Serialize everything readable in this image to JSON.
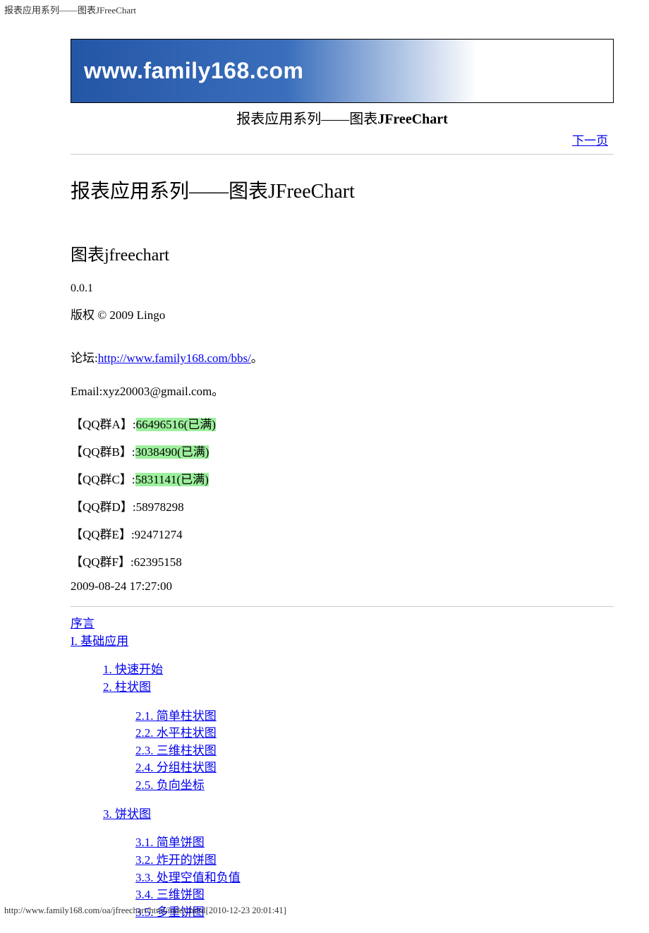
{
  "browserTitle": "报表应用系列——图表JFreeChart",
  "bannerText": "www.family168.com",
  "docBarTitlePrefix": "报表应用系列——图表",
  "docBarTitleBold": "JFreeChart",
  "nextPageLabel": "下一页",
  "mainTitle": "报表应用系列——图表JFreeChart",
  "subTitle": "图表jfreechart",
  "version": "0.0.1",
  "copyright": "版权 © 2009 Lingo",
  "forumLabel": "论坛:",
  "forumLink": "http://www.family168.com/bbs/",
  "forumPeriod": "。",
  "emailLine": "Email:xyz20003@gmail.com。",
  "qqGroups": [
    {
      "label": "【QQ群A】:",
      "highlighted": true,
      "value": "66496516(已满)"
    },
    {
      "label": "【QQ群B】:",
      "highlighted": true,
      "value": "3038490(已满)"
    },
    {
      "label": "【QQ群C】:",
      "highlighted": true,
      "value": "5831141(已满)"
    },
    {
      "label": "【QQ群D】:",
      "highlighted": false,
      "value": "58978298"
    },
    {
      "label": "【QQ群E】:",
      "highlighted": false,
      "value": "92471274"
    },
    {
      "label": "【QQ群F】:",
      "highlighted": false,
      "value": "62395158"
    }
  ],
  "timestamp": "2009-08-24 17:27:00",
  "toc": {
    "preface": "序言",
    "part1": "I. 基础应用",
    "ch1": "1. 快速开始",
    "ch2": "2. 柱状图",
    "ch2Items": [
      "2.1. 简单柱状图",
      "2.2. 水平柱状图",
      "2.3. 三维柱状图",
      "2.4. 分组柱状图",
      "2.5. 负向坐标"
    ],
    "ch3": "3. 饼状图",
    "ch3Items": [
      "3.1. 简单饼图",
      "3.2. 炸开的饼图",
      "3.3. 处理空值和负值",
      "3.4. 三维饼图",
      "3.5. 多重饼图"
    ]
  },
  "footerUrl": "http://www.family168.com/oa/jfreechart/html/index.html[2010-12-23 20:01:41]"
}
